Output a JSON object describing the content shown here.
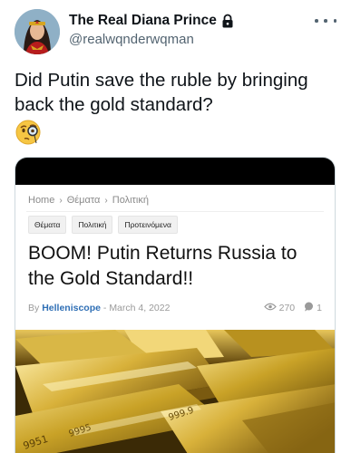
{
  "tweet": {
    "display_name": "The Real Diana Prince",
    "handle": "@realwqnderwqman",
    "text": "Did Putin save the ruble by bringing back the gold standard?",
    "emoji": "🧐"
  },
  "article": {
    "breadcrumb": [
      "Home",
      "Θέματα",
      "Πολιτική"
    ],
    "breadcrumb_separator": "›",
    "tags": [
      "Θέματα",
      "Πολιτική",
      "Προτεινόμενα"
    ],
    "title": "BOOM! Putin Returns Russia to the Gold Standard!!",
    "byline_prefix": "By",
    "author": "Helleniscope",
    "date_sep": "-",
    "date": "March 4, 2022",
    "views": "270",
    "comments": "1"
  },
  "icons": {
    "lock": "lock-icon",
    "more": "more-icon",
    "views": "eye-icon",
    "comments": "comment-icon"
  },
  "colors": {
    "text": "#0f1419",
    "secondary_text": "#536471",
    "link": "#2f6fb5",
    "gold": "#c9a227"
  }
}
